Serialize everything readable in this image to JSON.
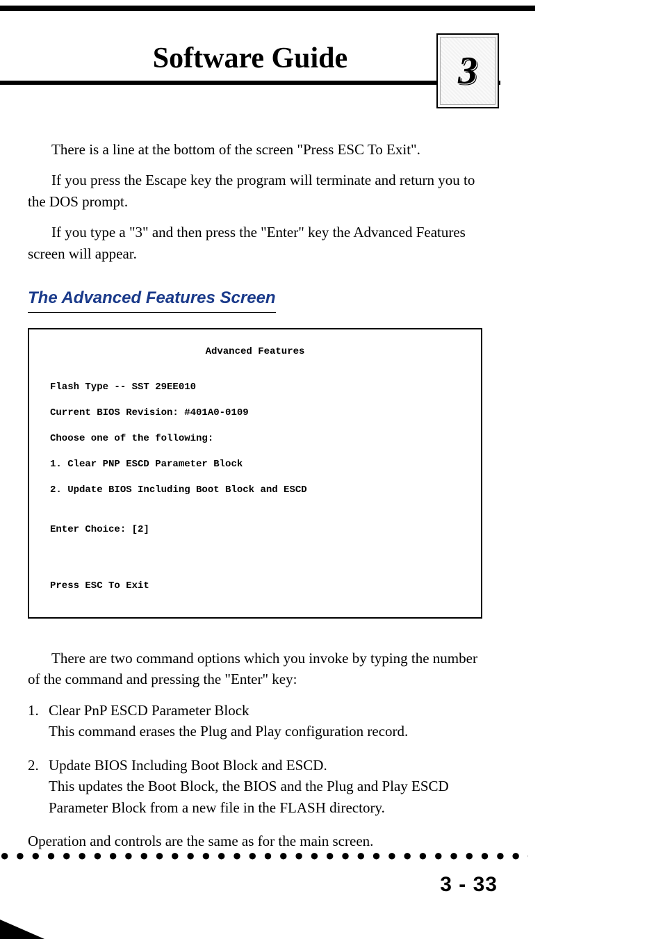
{
  "header": {
    "title": "Software Guide",
    "chapter_number": "3"
  },
  "body": {
    "p1": "There is a line at the bottom of the screen \"Press ESC To Exit\".",
    "p2": "If you press the Escape key the program will terminate and return you to the DOS prompt.",
    "p3": "If you type a \"3\" and then press the \"Enter\" key the Advanced Features screen will appear.",
    "section_heading": "The Advanced Features Screen",
    "p4": "There are two command options which you invoke by typing the number of the command and pressing the \"Enter\" key:",
    "list": {
      "n1": "1.",
      "t1a": "Clear PnP ESCD Parameter Block",
      "t1b": "This command erases the Plug and Play configuration record.",
      "n2": "2.",
      "t2a": "Update BIOS Including Boot Block and ESCD.",
      "t2b": "This updates the Boot Block, the BIOS and the Plug and Play ESCD Parameter Block from a new file in the FLASH directory."
    },
    "p5": "Operation and controls are the same as for the main screen."
  },
  "terminal": {
    "title": "Advanced Features",
    "flash_type": "Flash Type -- SST 29EE010",
    "bios_rev": "Current BIOS Revision: #401A0-0109",
    "choose": "Choose one of the following:",
    "opt1": "1. Clear PNP ESCD Parameter Block",
    "opt2": "2. Update BIOS Including Boot Block and ESCD",
    "enter_choice": "Enter Choice: [2]",
    "press_esc": "Press ESC To Exit"
  },
  "footer": {
    "dots": "●●●●●●●●●●●●●●●●●●●●●●●●●●●●●●●●●●●●●●●●●",
    "page_number": "3 - 33"
  }
}
